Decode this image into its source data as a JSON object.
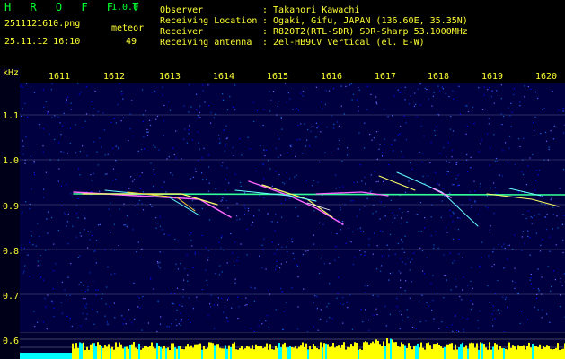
{
  "app": {
    "logo": "H R O F F T",
    "version": "1.0.0",
    "filename": "2511121610.png",
    "datetime": "25.11.12 16:10",
    "count_label": "meteor",
    "count_value": "49"
  },
  "info": {
    "observer_label": "Observer",
    "observer_value": ": Takanori Kawachi",
    "location_label": "Receiving Location",
    "location_value": ": Ogaki, Gifu, JAPAN (136.60E, 35.35N)",
    "receiver_label": "Receiver",
    "receiver_value": ": R820T2(RTL-SDR) SDR-Sharp 53.1000MHz",
    "antenna_label": "Receiving antenna",
    "antenna_value": ": 2el-HB9CV Vertical (el. E-W)"
  },
  "axis": {
    "unit": "kHz",
    "time_ticks": [
      "1611",
      "1612",
      "1613",
      "1614",
      "1615",
      "1616",
      "1617",
      "1618",
      "1619",
      "1620"
    ],
    "freq_ticks": [
      "1.1",
      "1.0",
      "0.9",
      "0.8",
      "0.7",
      "0.6"
    ]
  },
  "colors": {
    "header_green": "#00ff33",
    "header_yellow": "#ffff33",
    "background_blue": "#000040",
    "signal_line": "#33ff99",
    "strip_yellow": "#ffff00",
    "strip_cyan": "#00ffff"
  }
}
